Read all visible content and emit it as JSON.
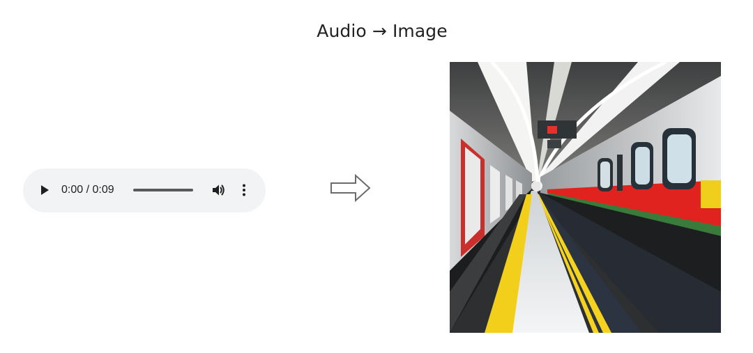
{
  "title": "Audio → Image",
  "audio_player": {
    "current_time": "0:00",
    "duration": "0:09",
    "time_display": "0:00 / 0:09",
    "progress_fraction": 0.0,
    "play_icon": "play-icon",
    "volume_icon": "volume-icon",
    "more_icon": "more-vert-icon",
    "background_color": "#f1f3f4"
  },
  "arrow": {
    "icon": "right-arrow-icon"
  },
  "output_image": {
    "description_icon": "subway-station-image",
    "colors": {
      "train_red_stripe": "#e0231f",
      "platform_yellow": "#f2cf1b",
      "train_body": "#e6e7e8"
    }
  }
}
